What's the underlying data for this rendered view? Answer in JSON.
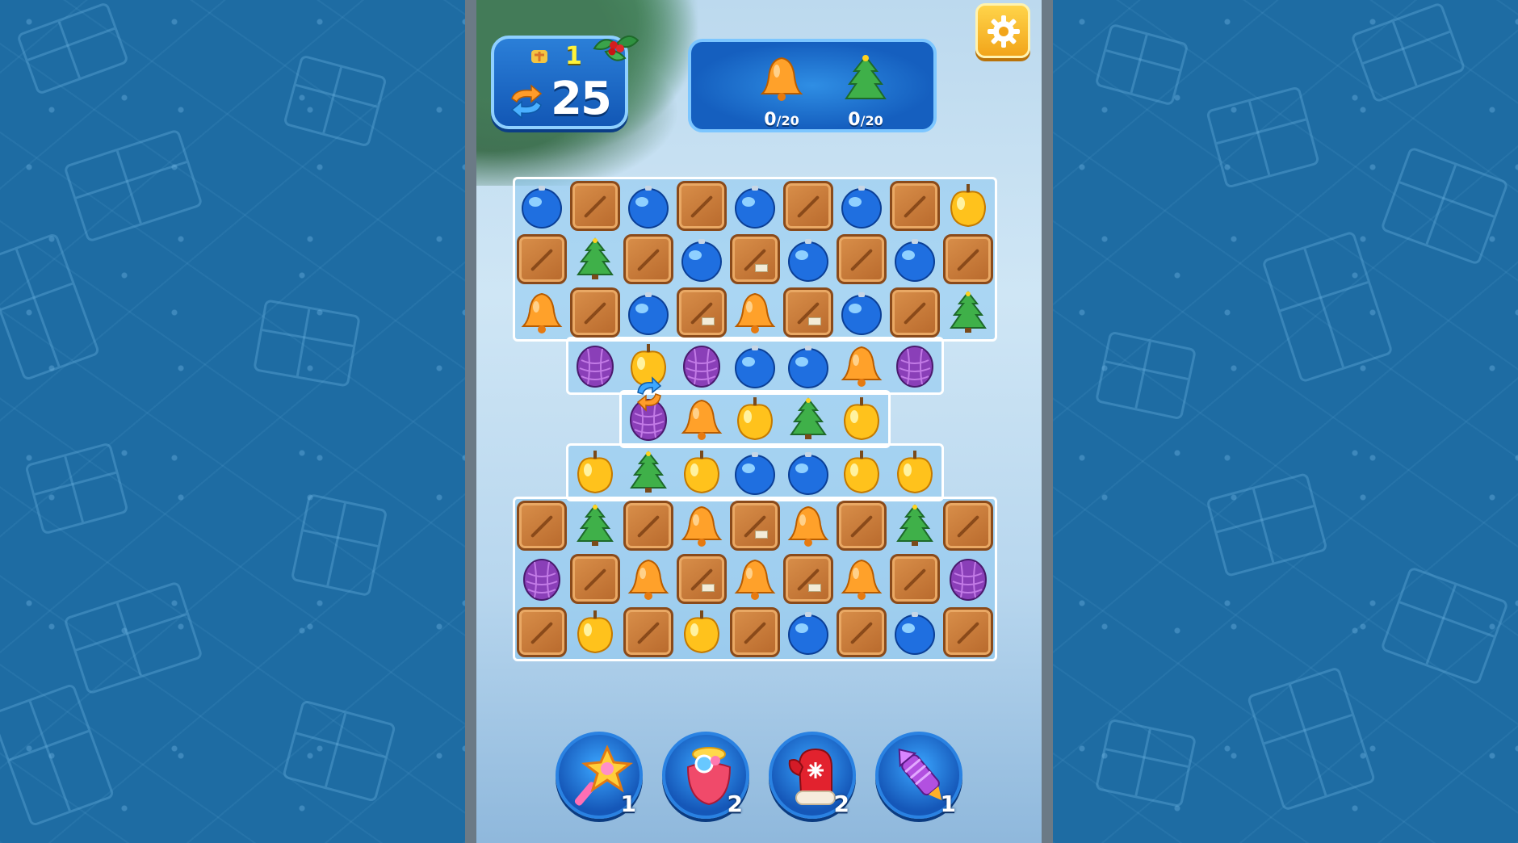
{
  "hud": {
    "level_number": "1",
    "moves_left": "25"
  },
  "goals": [
    {
      "item": "bell-icon",
      "count": "0",
      "total": "/20"
    },
    {
      "item": "christmas-tree-icon",
      "count": "0",
      "total": "/20"
    }
  ],
  "settings": {
    "icon": "gear-icon"
  },
  "board": {
    "legend": {
      "B": "blue-ornament",
      "C": "crate",
      "K": "crate-with-tag",
      "Y": "golden-apple",
      "T": "pine-tree",
      "L": "bell",
      "P": "purple-pinecone",
      "_": "empty"
    },
    "rows": [
      "BCBCBCBCY",
      "CTCBKBCBC",
      "LCBKLKBCT",
      "_PYPBBLP_",
      "__PLYTY__",
      "_YTYBBYY_",
      "CTCLKLCTC",
      "PCLKLKLCP",
      "CYCYCBCBC"
    ]
  },
  "boosters": [
    {
      "name": "star-wand",
      "count": "1"
    },
    {
      "name": "candy-jar",
      "count": "2"
    },
    {
      "name": "mitten",
      "count": "2"
    },
    {
      "name": "firework-rocket",
      "count": "1"
    }
  ],
  "colors": {
    "panel_blue": "#1e6fd0",
    "accent_gold": "#ffd44a",
    "crate_brown": "#c97a3a",
    "side_background": "#1e6ca3"
  }
}
